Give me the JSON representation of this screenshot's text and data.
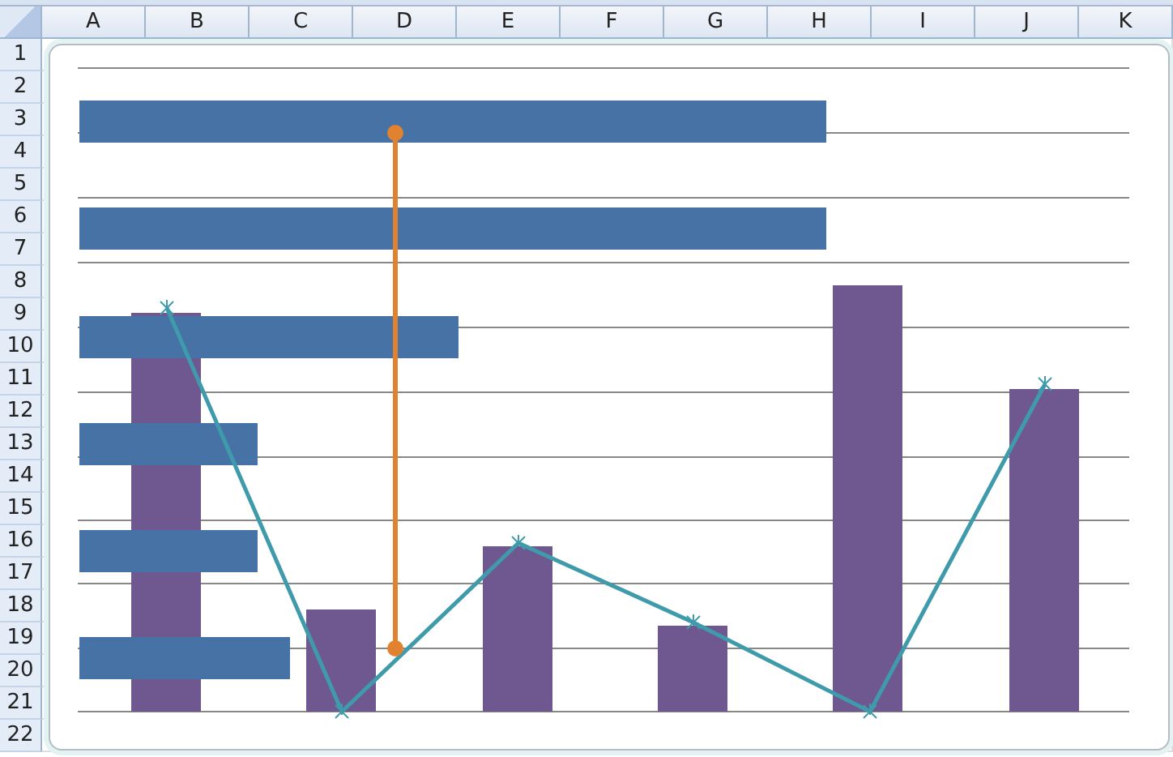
{
  "columns": [
    "A",
    "B",
    "C",
    "D",
    "E",
    "F",
    "G",
    "H",
    "I",
    "J",
    "K"
  ],
  "rows": [
    "1",
    "2",
    "3",
    "4",
    "5",
    "6",
    "7",
    "8",
    "9",
    "10",
    "11",
    "12",
    "13",
    "14",
    "15",
    "16",
    "17",
    "18",
    "19",
    "20",
    "21",
    "22"
  ]
}
